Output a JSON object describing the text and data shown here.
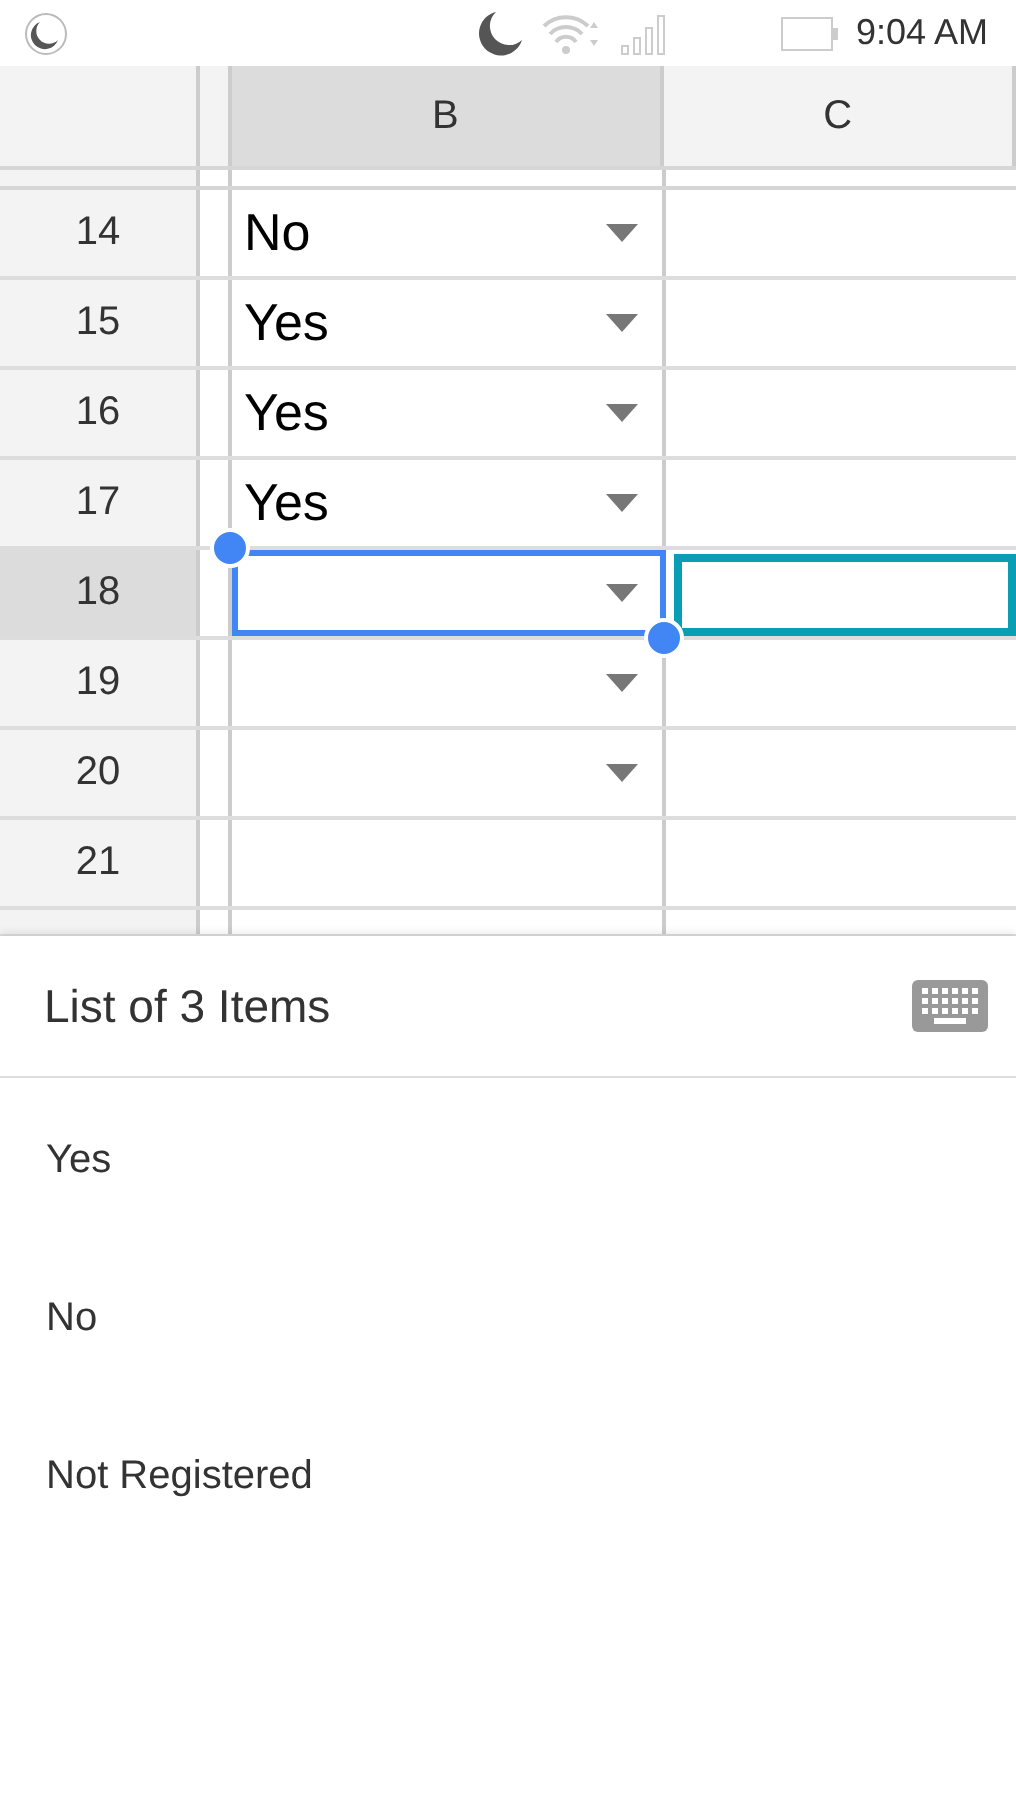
{
  "status_bar": {
    "time": "9:04 AM"
  },
  "columns": [
    {
      "label": "B",
      "selected": true
    },
    {
      "label": "C",
      "selected": false
    }
  ],
  "rows": [
    {
      "number": "14",
      "value": "No",
      "dropdown": true,
      "selected": false,
      "c_outlined": false
    },
    {
      "number": "15",
      "value": "Yes",
      "dropdown": true,
      "selected": false,
      "c_outlined": false
    },
    {
      "number": "16",
      "value": "Yes",
      "dropdown": true,
      "selected": false,
      "c_outlined": false
    },
    {
      "number": "17",
      "value": "Yes",
      "dropdown": true,
      "selected": false,
      "c_outlined": false
    },
    {
      "number": "18",
      "value": "",
      "dropdown": true,
      "selected": true,
      "c_outlined": true
    },
    {
      "number": "19",
      "value": "",
      "dropdown": true,
      "selected": false,
      "c_outlined": false
    },
    {
      "number": "20",
      "value": "",
      "dropdown": true,
      "selected": false,
      "c_outlined": false
    },
    {
      "number": "21",
      "value": "",
      "dropdown": false,
      "selected": false,
      "c_outlined": false
    }
  ],
  "sheet": {
    "title": "List of 3 Items",
    "items": [
      "Yes",
      "No",
      "Not Registered"
    ]
  }
}
